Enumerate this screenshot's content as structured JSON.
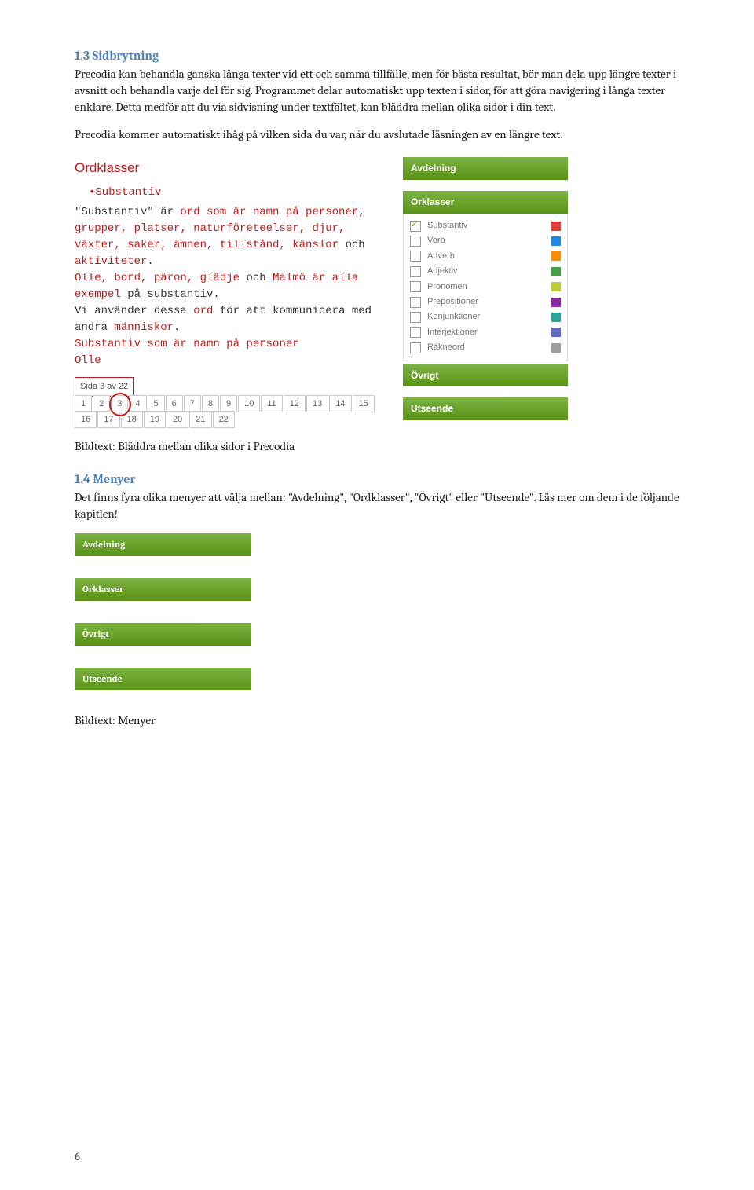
{
  "section13": {
    "title": "1.3 Sidbrytning",
    "p1": "Precodia kan behandla ganska långa texter vid ett och samma tillfälle, men för bästa resultat, bör man dela upp längre texter i avsnitt och behandla varje del för sig. Programmet delar automatiskt upp texten i sidor, för att göra navigering i långa texter enklare. Detta medför att du via sidvisning under textfältet, kan bläddra mellan olika sidor i din text.",
    "p2": "Precodia kommer automatiskt ihåg på vilken sida du var, när du avslutade läsningen av en längre text."
  },
  "reader": {
    "title": "Ordklasser",
    "bullet": "•Substantiv",
    "line_a_pre": "\"Substantiv\" är ",
    "line_a_hl": "ord som är namn på personer, grupper, platser, naturföreteelser, djur, växter, saker, ämnen, tillstånd, känslor",
    "line_a_mid": " och ",
    "line_a_hl2": "aktiviteter",
    "line_a_post": ".",
    "line_b_hl": "Olle, bord, päron, glädje",
    "line_b_mid": " och ",
    "line_b_hl2": "Malmö är alla exempel",
    "line_b_post": " på substantiv.",
    "line_c_pre": "Vi använder dessa ",
    "line_c_hl": "ord",
    "line_c_mid": " för att kommunicera med andra ",
    "line_c_hl2": "människor",
    "line_c_post": ".",
    "line_d": "Substantiv som är namn på personer",
    "line_e": "Olle"
  },
  "pager": {
    "label": "Sida 3 av 22",
    "pages_row1": [
      "1",
      "2",
      "3",
      "4",
      "5",
      "6",
      "7",
      "8",
      "9",
      "10",
      "11",
      "12",
      "13",
      "14",
      "15"
    ],
    "pages_row2": [
      "16",
      "17",
      "18",
      "19",
      "20",
      "21",
      "22"
    ],
    "current": "3"
  },
  "accordion": {
    "avdelning": "Avdelning",
    "orklasser": "Orklasser",
    "ovrigt": "Övrigt",
    "utseende": "Utseende",
    "items": [
      {
        "label": "Substantiv",
        "color": "#e53935",
        "checked": true
      },
      {
        "label": "Verb",
        "color": "#1e88e5",
        "checked": false
      },
      {
        "label": "Adverb",
        "color": "#fb8c00",
        "checked": false
      },
      {
        "label": "Adjektiv",
        "color": "#43a047",
        "checked": false
      },
      {
        "label": "Pronomen",
        "color": "#c0ca33",
        "checked": false
      },
      {
        "label": "Prepositioner",
        "color": "#8e24aa",
        "checked": false
      },
      {
        "label": "Konjunktioner",
        "color": "#26a69a",
        "checked": false
      },
      {
        "label": "Interjektioner",
        "color": "#5c6bc0",
        "checked": false
      },
      {
        "label": "Räkneord",
        "color": "#9e9e9e",
        "checked": false
      }
    ]
  },
  "caption1": "Bildtext: Bläddra mellan olika sidor i Precodia",
  "section14": {
    "title": "1.4 Menyer",
    "p1": "Det finns fyra olika menyer att välja mellan: \"Avdelning\", \"Ordklasser\", \"Övrigt\" eller \"Utseende\". Läs mer om dem i de följande kapitlen!"
  },
  "caption2": "Bildtext: Menyer",
  "page_number": "6"
}
